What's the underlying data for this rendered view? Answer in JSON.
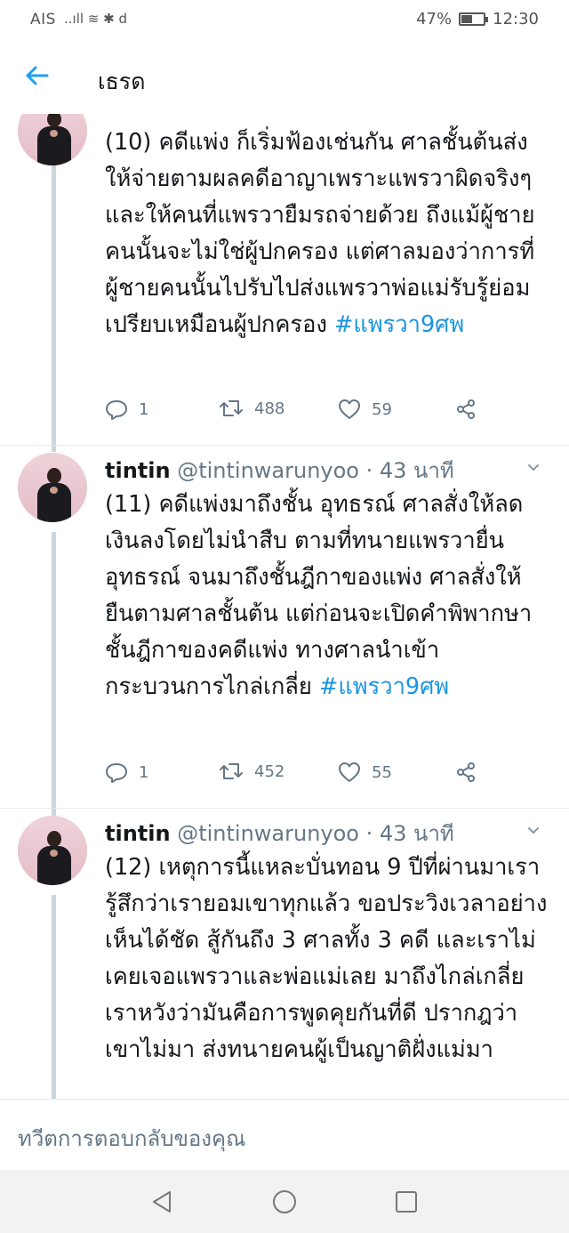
{
  "status_bar": {
    "carrier": "AIS",
    "indicators": "..ıll ≋ ✱ d",
    "battery": "47%",
    "time": "12:30"
  },
  "header": {
    "title": "เธรด",
    "back_icon": "arrow-left-icon"
  },
  "tweets": [
    {
      "name": "",
      "handle": "",
      "text": "(10) คดีแพ่ง ก็เริ่มฟ้องเช่นกัน  ศาลชั้นต้นส่งให้จ่ายตามผลคดีอาญาเพราะแพรวาผิดจริงๆ และให้คนที่แพรวายืมรถจ่ายด้วย ถึงแม้ผู้ชายคนนั้นจะไม่ใช่ผู้ปกครอง แต่ศาลมองว่าการที่ผู้ชายคนนั้นไปรับไปส่งแพรวาพ่อแม่รับรู้ย่อมเปรียบเหมือนผู้ปกครอง",
      "hashtag": "#แพรวา9ศพ",
      "replies": "1",
      "retweets": "488",
      "likes": "59"
    },
    {
      "name": "tintin",
      "handle": "@tintinwarunyoo · 43 นาที",
      "text": "(11) คดีแพ่งมาถึงชั้น อุทธรณ์ ศาลสั่งให้ลดเงินลงโดยไม่นำสืบ  ตามที่ทนายแพรวายื่นอุทธรณ์ จนมาถึงชั้นฎีกาของแพ่ง ศาลสั่งให้ยืนตามศาลชั้นต้น  แต่ก่อนจะเปิดคำพิพากษาชั้นฎีกาของคดีแพ่ง  ทางศาลนำเข้ากระบวนการไกล่เกลี่ย",
      "hashtag": "#แพรวา9ศพ",
      "replies": "1",
      "retweets": "452",
      "likes": "55"
    },
    {
      "name": "tintin",
      "handle": "@tintinwarunyoo · 43 นาที",
      "text": "(12) เหตุการนี้แหละบั่นทอน 9 ปีที่ผ่านมาเรารู้สึกว่าเรายอมเขาทุกแล้ว ขอประวิงเวลาอย่างเห็นได้ชัด สู้กันถึง 3 ศาลทั้ง 3 คดี และเราไม่เคยเจอแพรวาและพ่อแม่เลย มาถึงไกล่เกลี่ยเราหวังว่ามันคือการพูดคุยกันที่ดี ปรากฎว่าเขาไม่มา ส่งทนายคนผู้เป็นญาติฝั่งแม่มา",
      "hashtag": "",
      "replies": "",
      "retweets": "",
      "likes": ""
    }
  ],
  "reply_bar": {
    "placeholder": "ทวีตการตอบกลับของคุณ"
  },
  "nav_bar": {
    "back": "nav-back-icon",
    "home": "nav-home-icon",
    "recents": "nav-recents-icon"
  },
  "colors": {
    "accent": "#1b95e0",
    "secondary_text": "#657786",
    "thread_line": "#ccd6dd"
  }
}
